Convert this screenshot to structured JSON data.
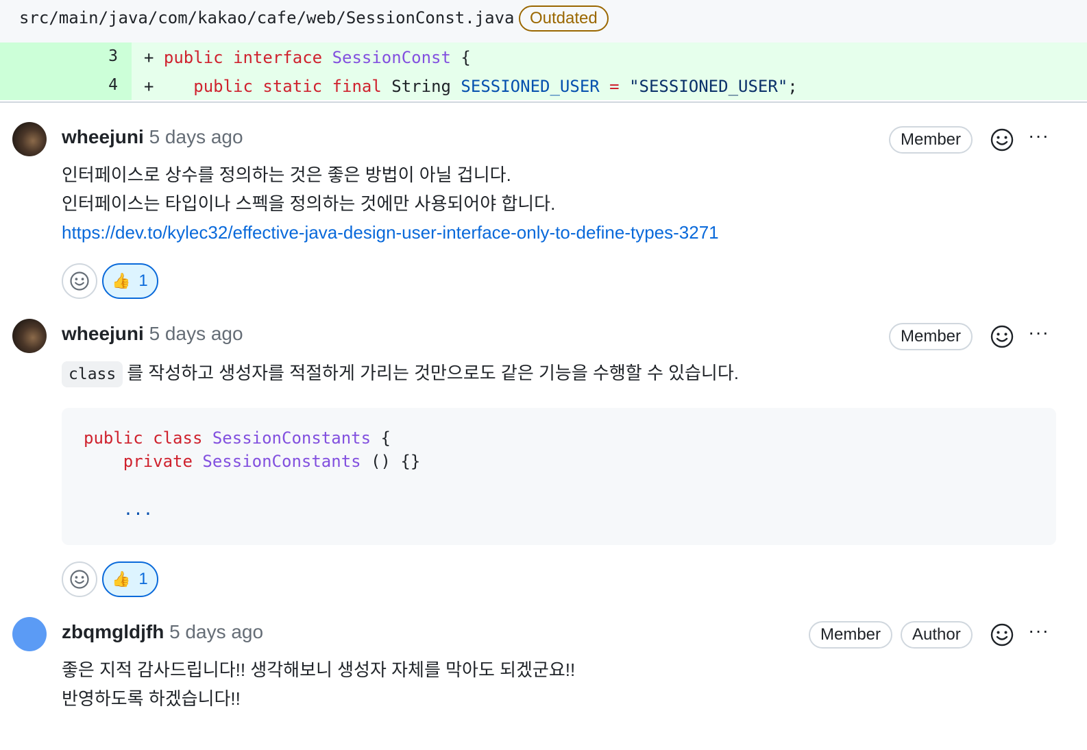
{
  "file": {
    "path": "src/main/java/com/kakao/cafe/web/SessionConst.java",
    "badge": "Outdated"
  },
  "diff": {
    "lines": [
      {
        "number": "3",
        "sign": "+",
        "tokens": {
          "t1": "public",
          "t2": "interface",
          "t3": "SessionConst",
          "t4": "{"
        }
      },
      {
        "number": "4",
        "sign": "+",
        "tokens": {
          "t1": "public",
          "t2": "static",
          "t3": "final",
          "t4": "String",
          "t5": "SESSIONED_USER",
          "t6": "=",
          "t7": "\"SESSIONED_USER\"",
          "t8": ";"
        }
      }
    ]
  },
  "comments": [
    {
      "author": "wheejuni",
      "time": "5 days ago",
      "badges": [
        "Member"
      ],
      "lines": [
        "인터페이스로 상수를 정의하는 것은 좋은 방법이 아닐 겁니다.",
        "인터페이스는 타입이나 스펙을 정의하는 것에만 사용되어야 합니다."
      ],
      "link": "https://dev.to/kylec32/effective-java-design-user-interface-only-to-define-types-3271",
      "reaction": {
        "emoji": "👍",
        "count": "1"
      }
    },
    {
      "author": "wheejuni",
      "time": "5 days ago",
      "badges": [
        "Member"
      ],
      "inline_code": "class",
      "text": "를 작성하고 생성자를 적절하게 가리는 것만으로도 같은 기능을 수행할 수 있습니다.",
      "code": {
        "l1": {
          "a": "public",
          "b": "class",
          "c": "SessionConstants",
          "d": "{"
        },
        "l2": {
          "a": "private",
          "b": "SessionConstants",
          "c": "() {}"
        },
        "l3": "..."
      },
      "reaction": {
        "emoji": "👍",
        "count": "1"
      }
    },
    {
      "author": "zbqmgldjfh",
      "time": "5 days ago",
      "badges": [
        "Member",
        "Author"
      ],
      "lines": [
        "좋은 지적 감사드립니다!! 생각해보니 생성자 자체를 막아도 되겠군요!!",
        "반영하도록 하겠습니다!!"
      ]
    }
  ],
  "more_label": "···"
}
